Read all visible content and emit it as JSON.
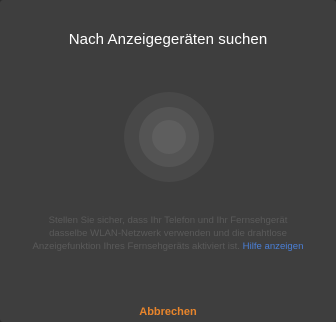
{
  "dialog": {
    "title": "Nach Anzeigegeräten suchen",
    "message": "Stellen Sie sicher, dass Ihr Telefon und Ihr Fernsehgerät dasselbe WLAN-Netzwerk verwenden und die drahtlose Anzeigefunktion Ihres Fernsehgeräts aktiviert ist.",
    "help_link": "Hilfe anzeigen",
    "cancel_label": "Abbrechen",
    "spinner_icon": "scanning-radar-icon"
  },
  "colors": {
    "background": "#2c2c2c",
    "dialog_background": "#3e3e3e",
    "title_text": "#ffffff",
    "body_text": "#5a5a5a",
    "link": "#4a7fd6",
    "accent": "#e8852c"
  }
}
